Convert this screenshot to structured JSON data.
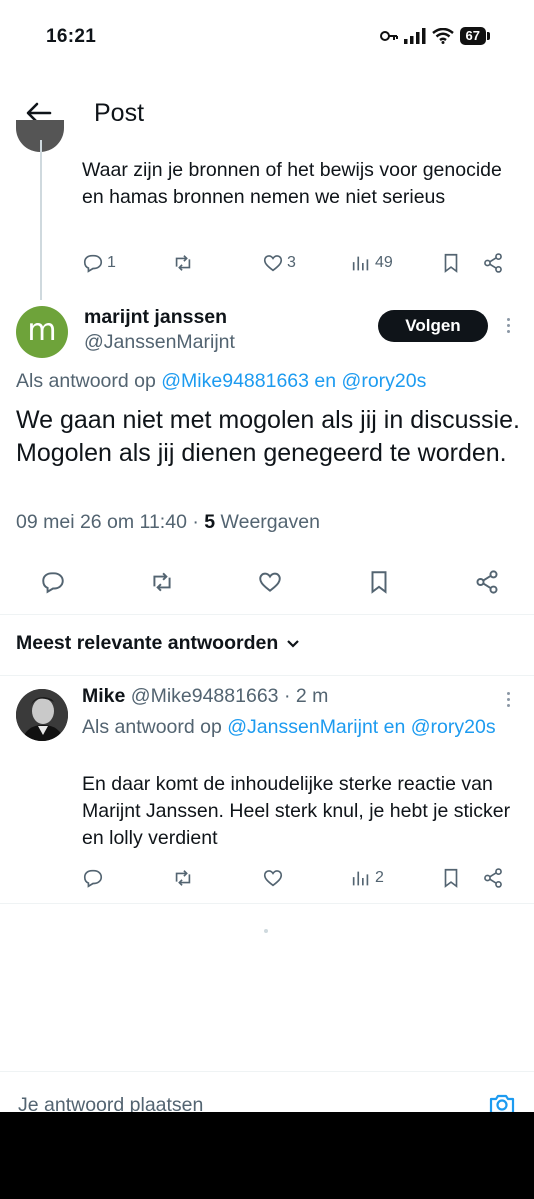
{
  "status_bar": {
    "time": "16:21",
    "battery": "67"
  },
  "header": {
    "title": "Post"
  },
  "parent_tweet": {
    "text": "Waar zijn je bronnen of het bewijs voor genocide en hamas bronnen nemen we niet serieus",
    "replies": "1",
    "likes": "3",
    "views": "49"
  },
  "main_tweet": {
    "avatar_letter": "m",
    "name": "marijnt janssen",
    "handle": "@JanssenMarijnt",
    "follow_label": "Volgen",
    "reply_prefix": "Als antwoord op",
    "reply_mention_1": "@Mike94881663",
    "reply_and": "en",
    "reply_mention_2": "@rory20s",
    "text": "We gaan niet met mogolen als jij in discussie.  Mogolen als jij dienen genegeerd te worden.",
    "date": "09 mei 26 om 11:40",
    "separator": "·",
    "views_count": "5",
    "views_label": "Weergaven"
  },
  "sort": {
    "label": "Meest relevante antwoorden"
  },
  "reply": {
    "name": "Mike",
    "handle": "@Mike94881663",
    "time": "· 2 m",
    "reply_prefix": "Als antwoord op",
    "reply_mention_1": "@JanssenMarijnt",
    "reply_and": "en",
    "reply_mention_2": "@rory20s",
    "text": "En daar komt de inhoudelijke sterke reactie van Marijnt Janssen. Heel sterk knul, je hebt je sticker en lolly verdient",
    "views": "2"
  },
  "compose": {
    "placeholder": "Je antwoord plaatsen"
  },
  "colors": {
    "link": "#1d9bf0",
    "muted": "#536471",
    "follow_bg": "#0f1419",
    "avatar_green": "#6ea33a"
  }
}
